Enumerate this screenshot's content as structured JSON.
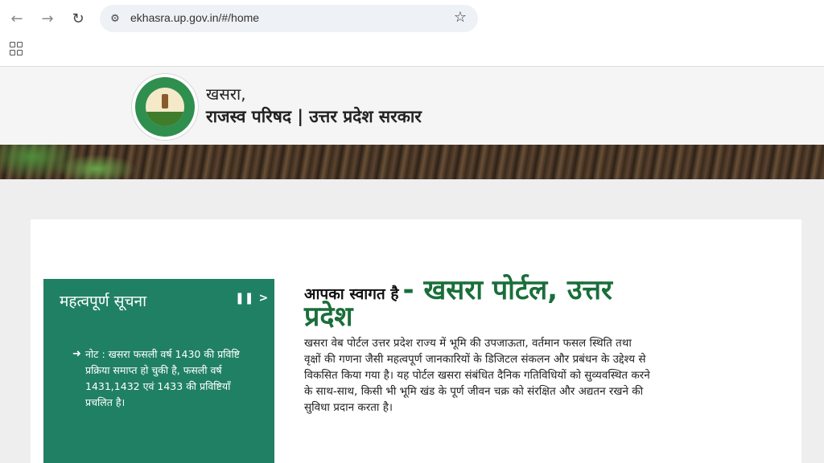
{
  "browser": {
    "url": "ekhasra.up.gov.in/#/home",
    "icons": {
      "back": "arrow-left-icon",
      "forward": "arrow-right-icon",
      "reload": "reload-icon",
      "site_info": "site-info-icon",
      "bookmark": "star-icon",
      "apps": "apps-grid-icon"
    }
  },
  "header": {
    "title_line1": "खसरा,",
    "title_line2": "राजस्व परिषद | उत्तर प्रदेश सरकार"
  },
  "notice": {
    "title": "महत्वपूर्ण सूचना",
    "pause_icon": "❚❚",
    "next_icon": ">",
    "text": "नोट : खसरा फसली वर्ष 1430 की प्रविष्टि प्रक्रिया समाप्त हो चुकी है, फसली वर्ष 1431,1432 एवं 1433 की प्रविष्टियाँ प्रचलित है।"
  },
  "welcome": {
    "lead": "आपका स्वागत है",
    "headline": "- खसरा पोर्टल, उत्तर प्रदेश",
    "body": "खसरा वेब पोर्टल उत्तर प्रदेश राज्य में भूमि की उपजाऊता, वर्तमान फसल स्थिति तथा वृक्षों की गणना जैसी महत्वपूर्ण जानकारियों के डिजिटल संकलन और प्रबंधन के उद्देश्य से विकसित किया गया है। यह पोर्टल खसरा संबंधित दैनिक गतिविधियों को सुव्यवस्थित करने के साथ-साथ, किसी भी भूमि खंड के पूर्ण जीवन चक्र को संरक्षित और अद्यतन रखने की सुविधा प्रदान करता है।"
  },
  "colors": {
    "accent": "#208063",
    "headline": "#1a6e3a",
    "page_bg": "#eeeeee"
  }
}
